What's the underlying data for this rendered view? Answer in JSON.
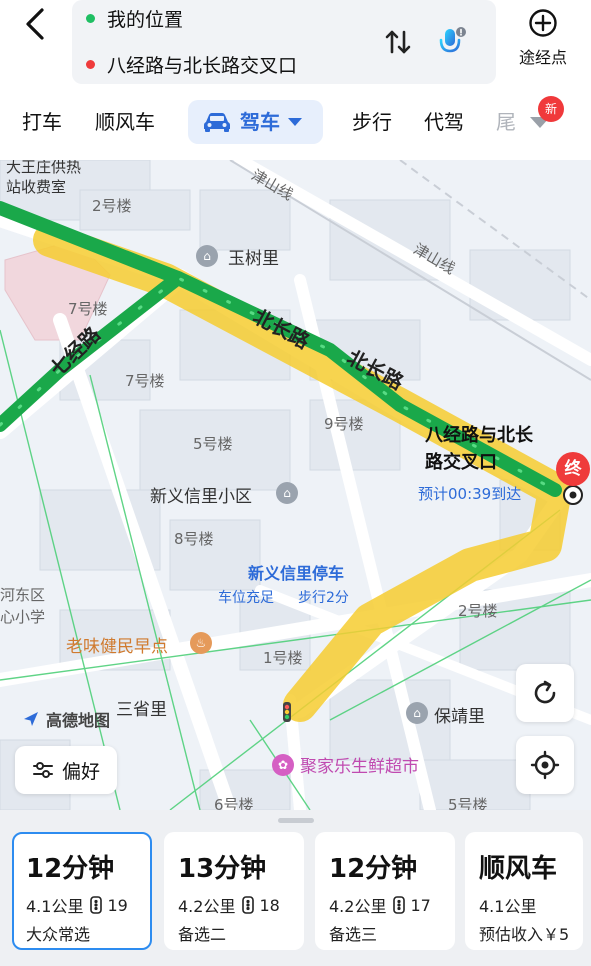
{
  "header": {
    "origin": "我的位置",
    "destination": "八经路与北长路交叉口",
    "waypoint_label": "途经点"
  },
  "modes": [
    "打车",
    "顺风车",
    "驾车",
    "步行",
    "代驾",
    "尾"
  ],
  "new_badge": "新",
  "map": {
    "labels": {
      "heating_station_1": "大王庄供热",
      "heating_station_2": "站收费室",
      "bldg_2": "2号楼",
      "yushuli": "玉树里",
      "jinshan_line_1": "津山线",
      "jinshan_line_2": "津山线",
      "bldg_7a": "7号楼",
      "bldg_7b": "7号楼",
      "bldg_5": "5号楼",
      "bldg_9": "9号楼",
      "xinyixinli_area": "新义信里小区",
      "bldg_8": "8号楼",
      "parking": "新义信里停车",
      "parking_status": "车位充足",
      "walk_info": "步行2分",
      "bldg_2b": "2号楼",
      "hedong_1": "河东区",
      "hedong_2": "心小学",
      "breakfast": "老味健民早点",
      "bldg_1": "1号楼",
      "sanshengli": "三省里",
      "baojingli": "保靖里",
      "supermarket": "聚家乐生鲜超市",
      "bldg_6": "6号楼",
      "bldg_5b": "5号楼"
    },
    "roads": {
      "qijing": "七经路",
      "beichang_1": "北长路",
      "beichang_2": "北长路"
    },
    "destination_label": "八经路与北长路交叉口",
    "destination_line1": "八经路与北长",
    "destination_line2": "路交叉口",
    "eta": "预计00:39到达",
    "end_marker": "终",
    "brand": "高德地图",
    "preference_label": "偏好"
  },
  "routes": [
    {
      "time": "12分钟",
      "distance": "4.1公里",
      "lights": "19",
      "tag": "大众常选",
      "selected": true
    },
    {
      "time": "13分钟",
      "distance": "4.2公里",
      "lights": "18",
      "tag": "备选二",
      "selected": false
    },
    {
      "time": "12分钟",
      "distance": "4.2公里",
      "lights": "17",
      "tag": "备选三",
      "selected": false
    },
    {
      "time": "顺风车",
      "distance": "4.1公里",
      "lights": "",
      "tag": "预估收入￥5",
      "selected": false
    }
  ],
  "colors": {
    "accent": "#2d6bd8",
    "route_green": "#1aa84a",
    "route_highlight": "#f6cc30",
    "end_red": "#ef3b3b"
  }
}
